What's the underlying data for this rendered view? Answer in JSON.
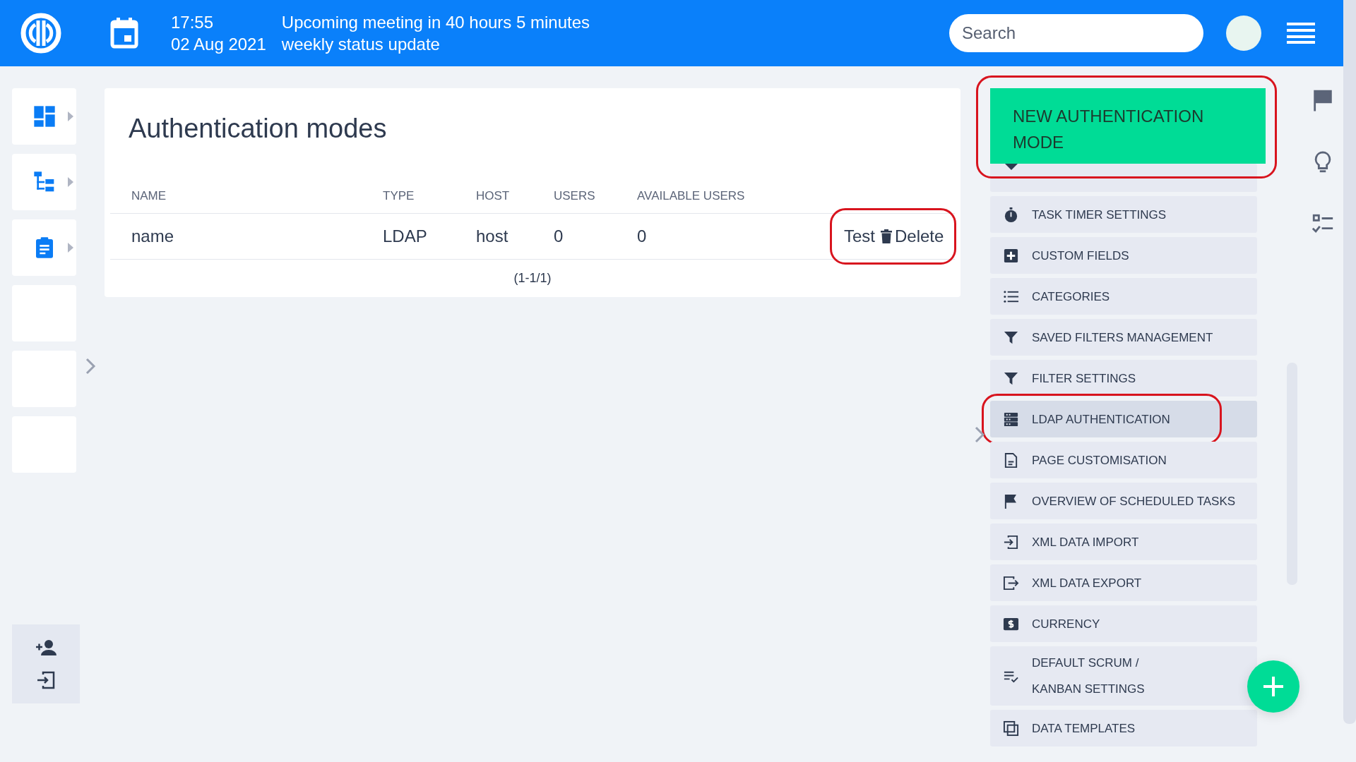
{
  "topbar": {
    "time": "17:55",
    "meeting": "Upcoming meeting in 40 hours 5 minutes",
    "date": "02 Aug 2021",
    "meeting_title": "weekly status update",
    "search": {
      "placeholder": "Search"
    }
  },
  "sidebar": {
    "items": [
      {
        "kind": "dashboard"
      },
      {
        "kind": "tree"
      },
      {
        "kind": "clipboard"
      },
      {
        "kind": "blank"
      },
      {
        "kind": "blank"
      },
      {
        "kind": "blank"
      }
    ],
    "bottom": [
      {
        "kind": "add-user"
      },
      {
        "kind": "login"
      }
    ]
  },
  "page": {
    "title": "Authentication modes",
    "table": {
      "columns": [
        "NAME",
        "TYPE",
        "HOST",
        "USERS",
        "AVAILABLE USERS"
      ],
      "rows": [
        {
          "cells": [
            "name",
            "LDAP",
            "host",
            "0",
            "0"
          ],
          "actions": [
            "Test",
            "Delete"
          ],
          "highlighted": true
        }
      ]
    },
    "pagination": "(1-1/1)"
  },
  "actions_menu": {
    "new_button": {
      "label": "NEW AUTHENTICATION MODE",
      "highlighted": true
    },
    "items": [
      {
        "kind": "partial",
        "selected": false,
        "highlighted": false
      },
      {
        "label": "TASK TIMER SETTINGS",
        "kind": "timer",
        "selected": false,
        "highlighted": false
      },
      {
        "label": "CUSTOM FIELDS",
        "kind": "plus",
        "selected": false,
        "highlighted": false
      },
      {
        "label": "CATEGORIES",
        "kind": "list",
        "selected": false,
        "highlighted": false
      },
      {
        "label": "SAVED FILTERS MANAGEMENT",
        "kind": "filter",
        "selected": false,
        "highlighted": false
      },
      {
        "label": "FILTER SETTINGS",
        "kind": "filter",
        "selected": false,
        "highlighted": false
      },
      {
        "label": "LDAP AUTHENTICATION",
        "kind": "server",
        "selected": true,
        "highlighted": true
      },
      {
        "label": "PAGE CUSTOMISATION",
        "kind": "document",
        "selected": false,
        "highlighted": false
      },
      {
        "label": "OVERVIEW OF SCHEDULED TASKS",
        "kind": "flag",
        "selected": false,
        "highlighted": false
      },
      {
        "label": "XML DATA IMPORT",
        "kind": "import",
        "selected": false,
        "highlighted": false
      },
      {
        "label": "XML DATA EXPORT",
        "kind": "export",
        "selected": false,
        "highlighted": false
      },
      {
        "label": "CURRENCY",
        "kind": "currency",
        "selected": false,
        "highlighted": false
      },
      {
        "label": "DEFAULT SCRUM / KANBAN SETTINGS",
        "kind": "checklist",
        "selected": false,
        "highlighted": false
      },
      {
        "label": "DATA TEMPLATES",
        "kind": "copy",
        "selected": false,
        "highlighted": false
      }
    ]
  },
  "side_icons": [
    {
      "kind": "flag"
    },
    {
      "kind": "bulb"
    },
    {
      "kind": "checklist"
    }
  ]
}
